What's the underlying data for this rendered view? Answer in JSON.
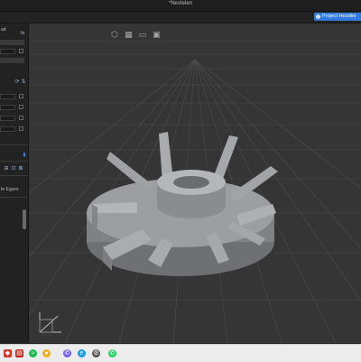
{
  "window": {
    "title": "*Nevtelen"
  },
  "toolbar": {
    "project_button": "Project Houdini"
  },
  "left_panel": {
    "top_label": "ad",
    "tabs_label": "te  Egyes"
  },
  "viewport": {
    "view_icons": [
      "cube-view-icon",
      "grid-view-icon",
      "folder-view-icon",
      "image-view-icon"
    ]
  },
  "taskbar": {
    "icons": [
      "start-icon",
      "pdf-icon",
      "spotify-icon",
      "chrome-icon",
      "viber-icon",
      "edge-icon",
      "settings-icon",
      "whatsapp-icon"
    ]
  },
  "colors": {
    "accent": "#2f7be0",
    "grid": "#5a5a5a",
    "model": "#9a9ca0"
  }
}
